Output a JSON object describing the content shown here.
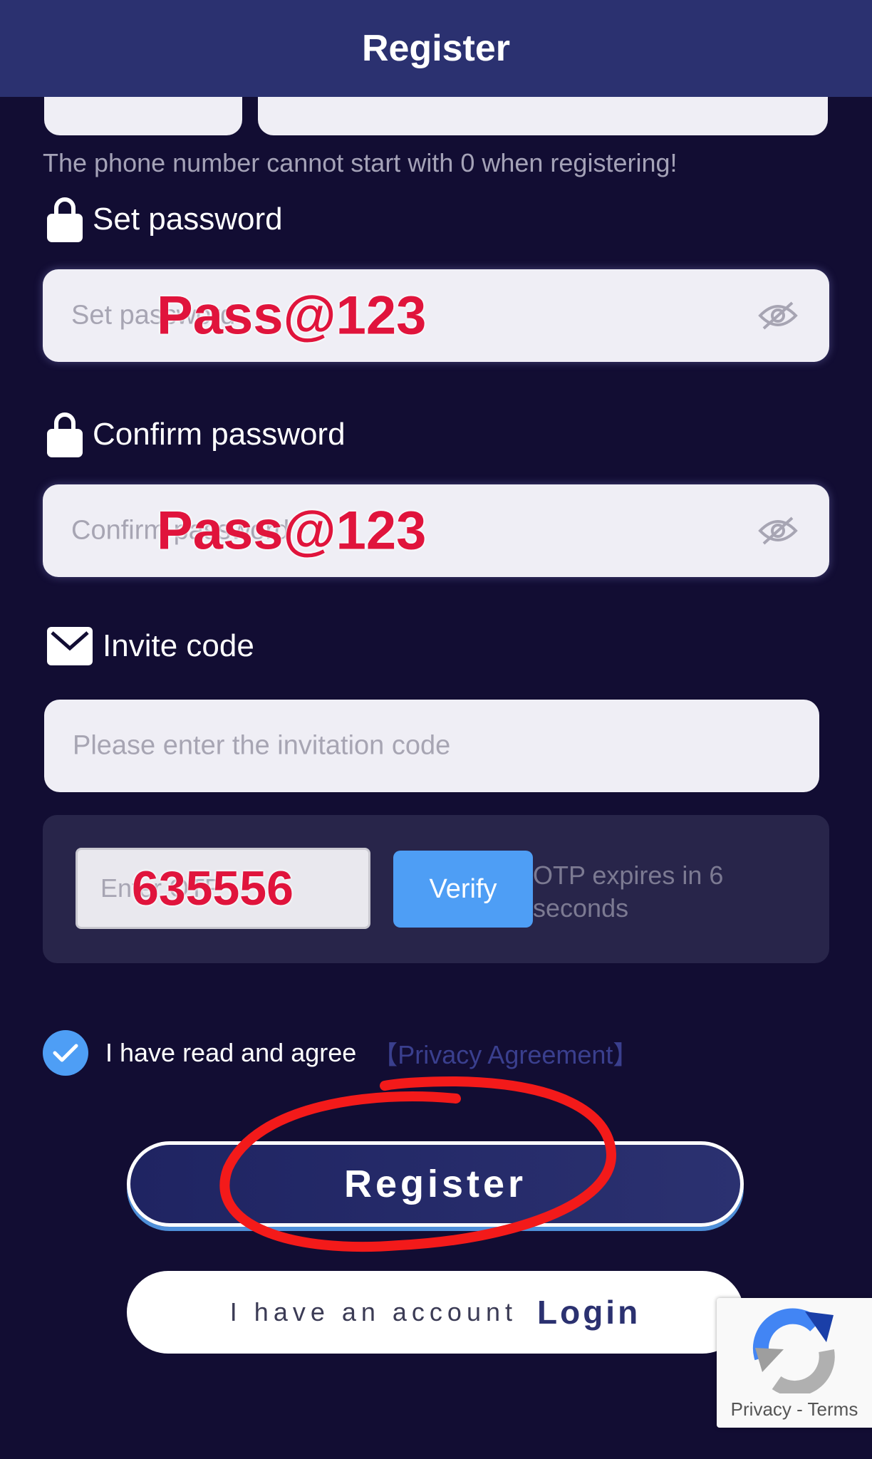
{
  "header": {
    "title": "Register"
  },
  "phone": {
    "hint": "The phone number cannot start with 0 when registering!"
  },
  "password": {
    "label": "Set password",
    "placeholder": "Set password",
    "overlay": "Pass@123",
    "icon": "lock-icon",
    "toggle_icon": "eye-off-icon"
  },
  "confirm_password": {
    "label": "Confirm password",
    "placeholder": "Confirm password",
    "overlay": "Pass@123",
    "icon": "lock-icon",
    "toggle_icon": "eye-off-icon"
  },
  "invite": {
    "label": "Invite code",
    "placeholder": "Please enter the invitation code",
    "icon": "envelope-icon"
  },
  "otp": {
    "placeholder": "Enter OTP",
    "overlay": "635556",
    "verify_label": "Verify",
    "timer_text": "OTP expires in 6 seconds"
  },
  "agreement": {
    "checked": true,
    "text": "I have read and agree",
    "link": "【Privacy Agreement】"
  },
  "register_button": {
    "label": "Register"
  },
  "login_row": {
    "prefix": "I have an account",
    "login_label": "Login"
  },
  "recaptcha": {
    "text": "Privacy - Terms",
    "icon": "recaptcha-logo-icon"
  },
  "colors": {
    "background": "#120d33",
    "header": "#2b3170",
    "accent": "#4e9ef5",
    "annotation_red": "#e0143c"
  }
}
